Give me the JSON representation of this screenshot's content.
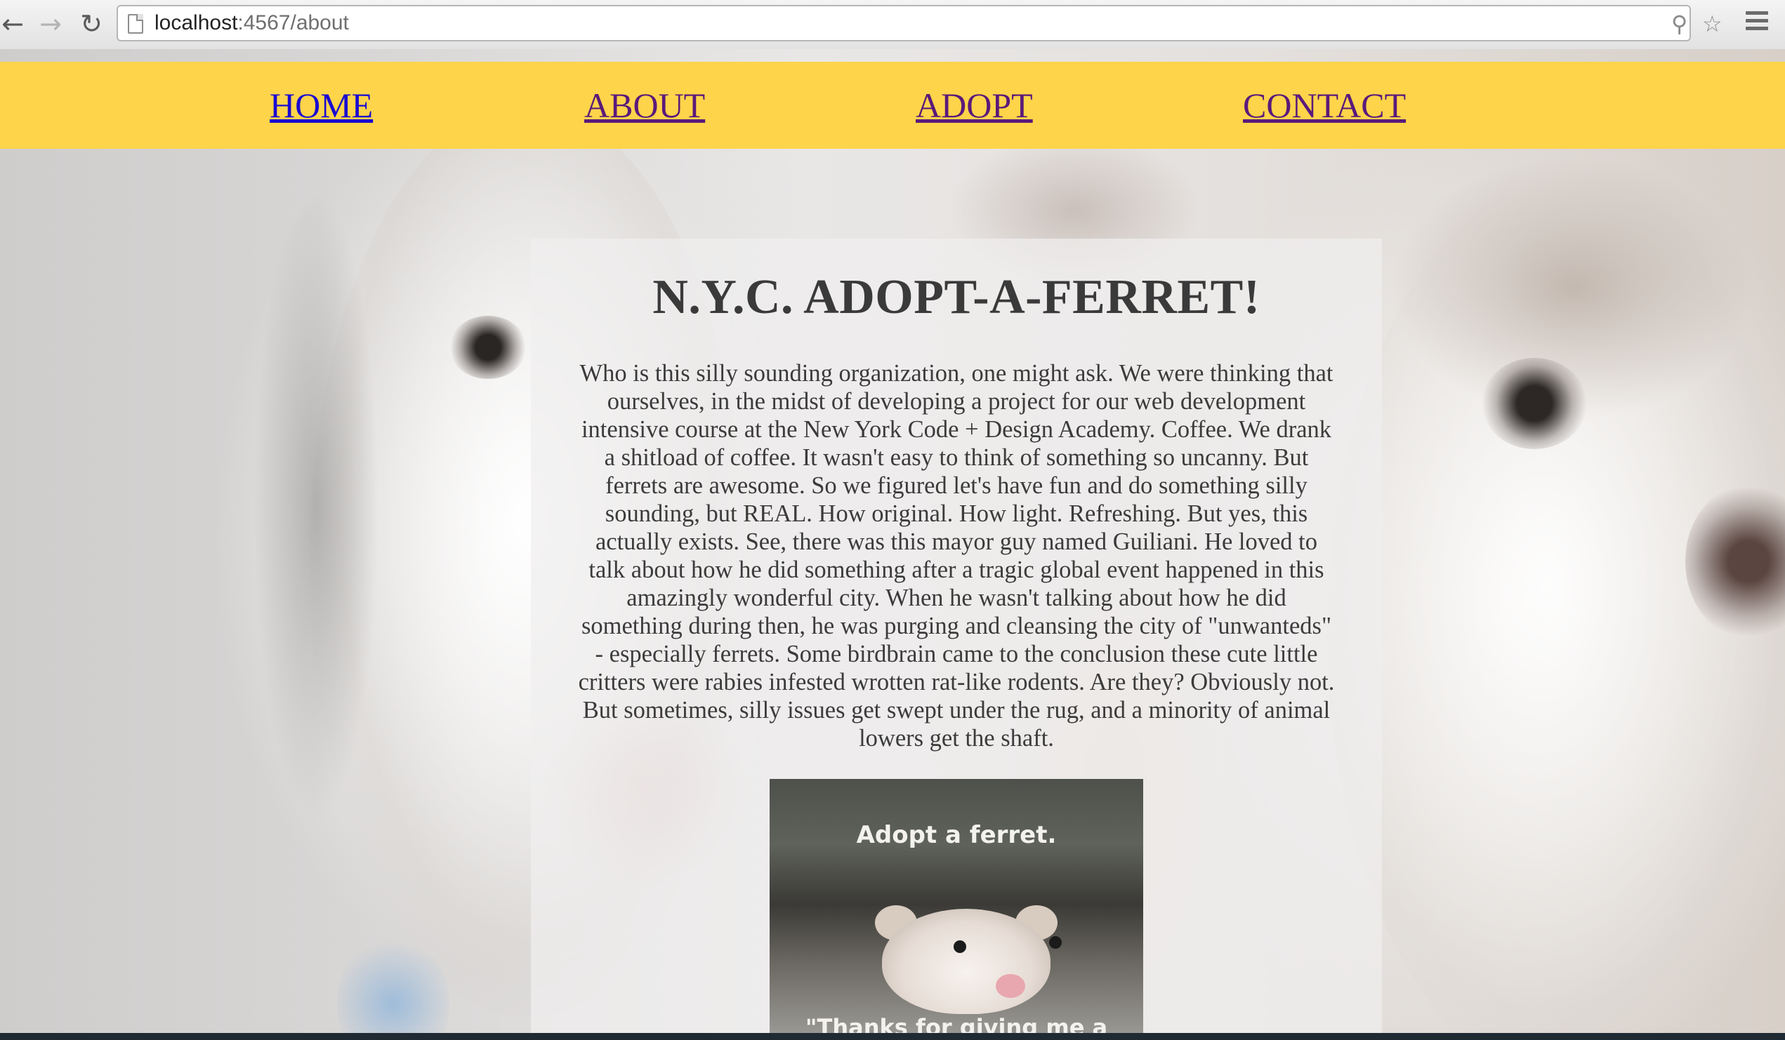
{
  "browser": {
    "url_host": "localhost",
    "url_port_path": ":4567/about",
    "back_icon": "arrow-left",
    "forward_icon": "arrow-right",
    "reload_icon": "reload",
    "zoom_icon": "magnifier",
    "bookmark_icon": "star",
    "menu_icon": "hamburger"
  },
  "nav": {
    "items": [
      {
        "label": "HOME",
        "state": "unvisited"
      },
      {
        "label": "ABOUT",
        "state": "visited"
      },
      {
        "label": "ADOPT",
        "state": "visited"
      },
      {
        "label": "CONTACT",
        "state": "visited"
      }
    ],
    "bar_color": "#fed44a"
  },
  "main": {
    "title": "N.Y.C. ADOPT-A-FERRET!",
    "body": "Who is this silly sounding organization, one might ask. We were thinking that ourselves, in the midst of developing a project for our web development intensive course at the New York Code + Design Academy. Coffee. We drank a shitload of coffee. It wasn't easy to think of something so uncanny. But ferrets are awesome. So we figured let's have fun and do something silly sounding, but REAL. How original. How light. Refreshing. But yes, this actually exists. See, there was this mayor guy named Guiliani. He loved to talk about how he did something after a tragic global event happened in this amazingly wonderful city. When he wasn't talking about how he did something during then, he was purging and cleansing the city of \"unwanteds\" - especially ferrets. Some birdbrain came to the conclusion these cute little critters were rabies infested wrotten rat-like rodents. Are they? Obviously not. But sometimes, silly issues get swept under the rug, and a minority of animal lowers get the shaft.",
    "poster": {
      "caption_top": "Adopt a ferret.",
      "caption_bottom": "\"Thanks for giving me a"
    }
  }
}
